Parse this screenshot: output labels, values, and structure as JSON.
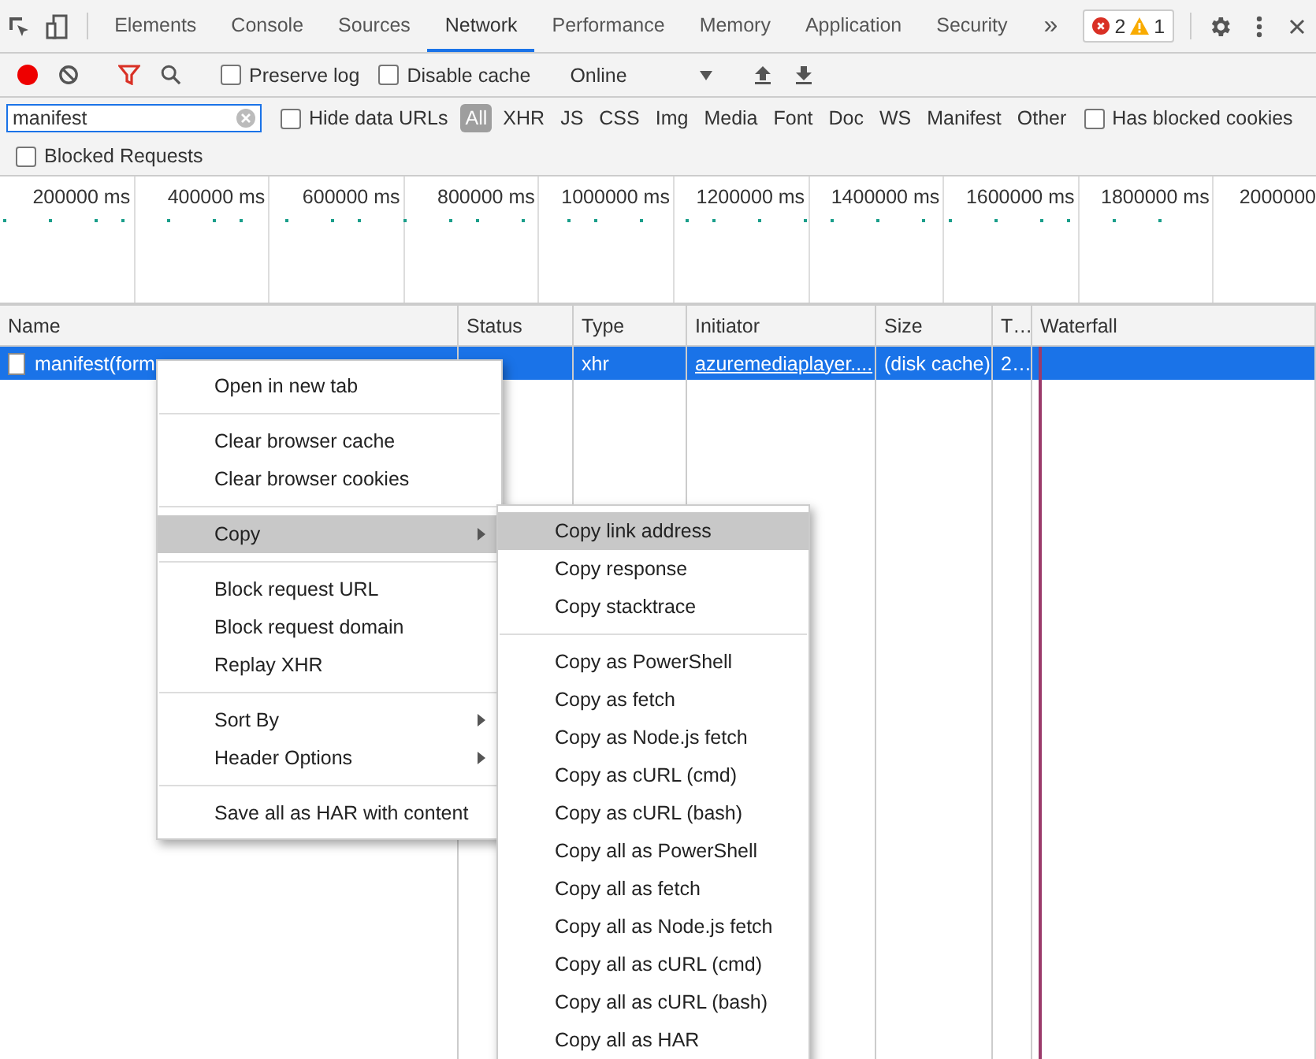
{
  "tabs": [
    {
      "label": "Elements",
      "selected": false
    },
    {
      "label": "Console",
      "selected": false
    },
    {
      "label": "Sources",
      "selected": false
    },
    {
      "label": "Network",
      "selected": true
    },
    {
      "label": "Performance",
      "selected": false
    },
    {
      "label": "Memory",
      "selected": false
    },
    {
      "label": "Application",
      "selected": false
    },
    {
      "label": "Security",
      "selected": false
    }
  ],
  "more_tabs": "»",
  "issues": {
    "errors": "2",
    "warnings": "1"
  },
  "toolbar": {
    "recording": true,
    "preserve_log": {
      "label": "Preserve log",
      "checked": false
    },
    "disable_cache": {
      "label": "Disable cache",
      "checked": false
    },
    "throttling": "Online"
  },
  "filter": {
    "value": "manifest",
    "hide_data_urls": {
      "label": "Hide data URLs",
      "checked": false
    },
    "types": [
      {
        "label": "All",
        "selected": true
      },
      {
        "label": "XHR",
        "selected": false
      },
      {
        "label": "JS",
        "selected": false
      },
      {
        "label": "CSS",
        "selected": false
      },
      {
        "label": "Img",
        "selected": false
      },
      {
        "label": "Media",
        "selected": false
      },
      {
        "label": "Font",
        "selected": false
      },
      {
        "label": "Doc",
        "selected": false
      },
      {
        "label": "WS",
        "selected": false
      },
      {
        "label": "Manifest",
        "selected": false
      },
      {
        "label": "Other",
        "selected": false
      }
    ],
    "has_blocked_cookies": {
      "label": "Has blocked cookies",
      "checked": false
    },
    "blocked_requests": {
      "label": "Blocked Requests",
      "checked": false
    }
  },
  "overview": {
    "ticks": [
      "200000 ms",
      "400000 ms",
      "600000 ms",
      "800000 ms",
      "1000000 ms",
      "1200000 ms",
      "1400000 ms",
      "1600000 ms",
      "1800000 ms",
      "2000000"
    ]
  },
  "table": {
    "columns": [
      "Name",
      "Status",
      "Type",
      "Initiator",
      "Size",
      "T…",
      "Waterfall"
    ],
    "rows": [
      {
        "name": "manifest(form",
        "type": "xhr",
        "initiator": "azuremediaplayer....",
        "size": "(disk cache)",
        "time": "2…",
        "selected": true
      }
    ]
  },
  "context_menu": {
    "groups": [
      [
        {
          "label": "Open in new tab",
          "submenu": false,
          "highlighted": false
        }
      ],
      [
        {
          "label": "Clear browser cache",
          "submenu": false,
          "highlighted": false
        },
        {
          "label": "Clear browser cookies",
          "submenu": false,
          "highlighted": false
        }
      ],
      [
        {
          "label": "Copy",
          "submenu": true,
          "highlighted": true
        }
      ],
      [
        {
          "label": "Block request URL",
          "submenu": false,
          "highlighted": false
        },
        {
          "label": "Block request domain",
          "submenu": false,
          "highlighted": false
        },
        {
          "label": "Replay XHR",
          "submenu": false,
          "highlighted": false
        }
      ],
      [
        {
          "label": "Sort By",
          "submenu": true,
          "highlighted": false
        },
        {
          "label": "Header Options",
          "submenu": true,
          "highlighted": false
        }
      ],
      [
        {
          "label": "Save all as HAR with content",
          "submenu": false,
          "highlighted": false
        }
      ]
    ]
  },
  "copy_submenu": {
    "groups": [
      [
        {
          "label": "Copy link address",
          "highlighted": true
        },
        {
          "label": "Copy response",
          "highlighted": false
        },
        {
          "label": "Copy stacktrace",
          "highlighted": false
        }
      ],
      [
        {
          "label": "Copy as PowerShell",
          "highlighted": false
        },
        {
          "label": "Copy as fetch",
          "highlighted": false
        },
        {
          "label": "Copy as Node.js fetch",
          "highlighted": false
        },
        {
          "label": "Copy as cURL (cmd)",
          "highlighted": false
        },
        {
          "label": "Copy as cURL (bash)",
          "highlighted": false
        },
        {
          "label": "Copy all as PowerShell",
          "highlighted": false
        },
        {
          "label": "Copy all as fetch",
          "highlighted": false
        },
        {
          "label": "Copy all as Node.js fetch",
          "highlighted": false
        },
        {
          "label": "Copy all as cURL (cmd)",
          "highlighted": false
        },
        {
          "label": "Copy all as cURL (bash)",
          "highlighted": false
        },
        {
          "label": "Copy all as HAR",
          "highlighted": false
        }
      ]
    ]
  }
}
